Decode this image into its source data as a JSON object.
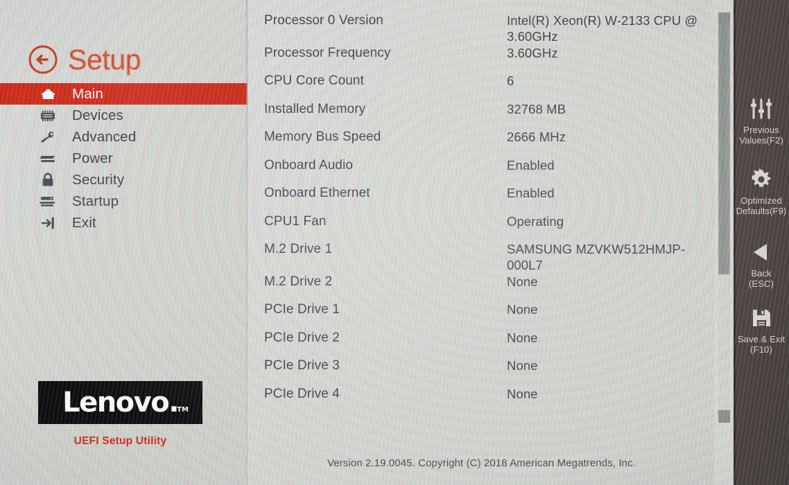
{
  "app": {
    "title": "Setup",
    "vendor_logo_text": "Lenovo",
    "vendor_logo_dot": ".",
    "vendor_logo_tm": "TM",
    "utility_caption": "UEFI Setup Utility",
    "footer_version": "Version 2.19.0045. Copyright (C) 2018 American Megatrends, Inc."
  },
  "colors": {
    "accent_red": "#cf2a18",
    "title_orange": "#d9512c",
    "panel_dark": "#4a4240",
    "screen_bg": "#d6d9d4",
    "text": "#3f4347"
  },
  "sidebar": {
    "back_icon": "back-arrow-circle-icon",
    "items": [
      {
        "label": "Main",
        "icon": "home-icon",
        "active": true
      },
      {
        "label": "Devices",
        "icon": "memory-chip-icon",
        "active": false
      },
      {
        "label": "Advanced",
        "icon": "wrench-icon",
        "active": false
      },
      {
        "label": "Power",
        "icon": "power-bars-icon",
        "active": false
      },
      {
        "label": "Security",
        "icon": "padlock-icon",
        "active": false
      },
      {
        "label": "Startup",
        "icon": "server-stack-icon",
        "active": false
      },
      {
        "label": "Exit",
        "icon": "exit-arrow-icon",
        "active": false
      }
    ]
  },
  "main": {
    "rows": [
      {
        "label": "Processor 0 Version",
        "value": "Intel(R) Xeon(R) W-2133 CPU @ 3.60GHz"
      },
      {
        "label": "Processor Frequency",
        "value": "3.60GHz"
      },
      {
        "label": "CPU Core Count",
        "value": "6"
      },
      {
        "label": "Installed Memory",
        "value": "32768 MB"
      },
      {
        "label": "Memory Bus Speed",
        "value": "2666 MHz"
      },
      {
        "label": "Onboard Audio",
        "value": "Enabled"
      },
      {
        "label": "Onboard Ethernet",
        "value": "Enabled"
      },
      {
        "label": "CPU1 Fan",
        "value": "Operating"
      },
      {
        "label": "M.2 Drive 1",
        "value": "SAMSUNG MZVKW512HMJP-000L7"
      },
      {
        "label": "M.2 Drive 2",
        "value": "None"
      },
      {
        "label": "PCIe Drive 1",
        "value": "None"
      },
      {
        "label": "PCIe Drive 2",
        "value": "None"
      },
      {
        "label": "PCIe Drive 3",
        "value": "None"
      },
      {
        "label": "PCIe Drive 4",
        "value": "None"
      }
    ]
  },
  "scrollbar": {
    "up_arrow": "scroll-up-arrow",
    "down_arrow": "scroll-down-arrow",
    "thumb_position_percent": 0,
    "thumb_size_percent": 62
  },
  "right_panel": {
    "buttons": [
      {
        "icon": "sliders-icon",
        "line1": "Previous",
        "line2": "Values(F2)"
      },
      {
        "icon": "gear-icon",
        "line1": "Optimized",
        "line2": "Defaults(F9)"
      },
      {
        "icon": "back-triangle-icon",
        "line1": "Back",
        "line2": "(ESC)"
      },
      {
        "icon": "floppy-save-icon",
        "line1": "Save & Exit",
        "line2": "(F10)"
      }
    ]
  }
}
